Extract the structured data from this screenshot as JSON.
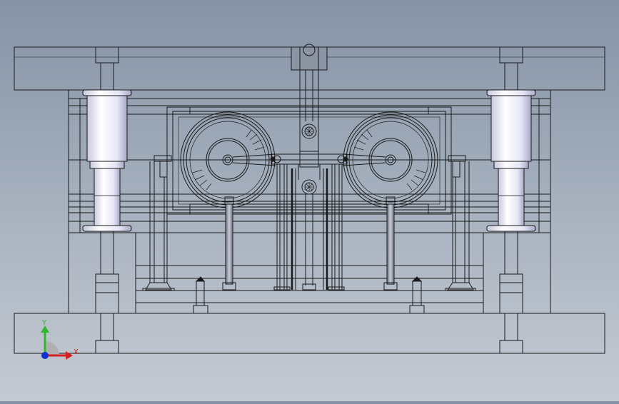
{
  "viewport": {
    "background_top": "#8593a6",
    "background_bottom": "#c4cad3",
    "line_color": "#1a1a1a",
    "pillar_color": "#e8e8f8"
  },
  "triad": {
    "y_label": "Y",
    "x_label": "X",
    "y_color": "#2fb82f",
    "x_color": "#d42020",
    "z_color": "#1030d0"
  }
}
